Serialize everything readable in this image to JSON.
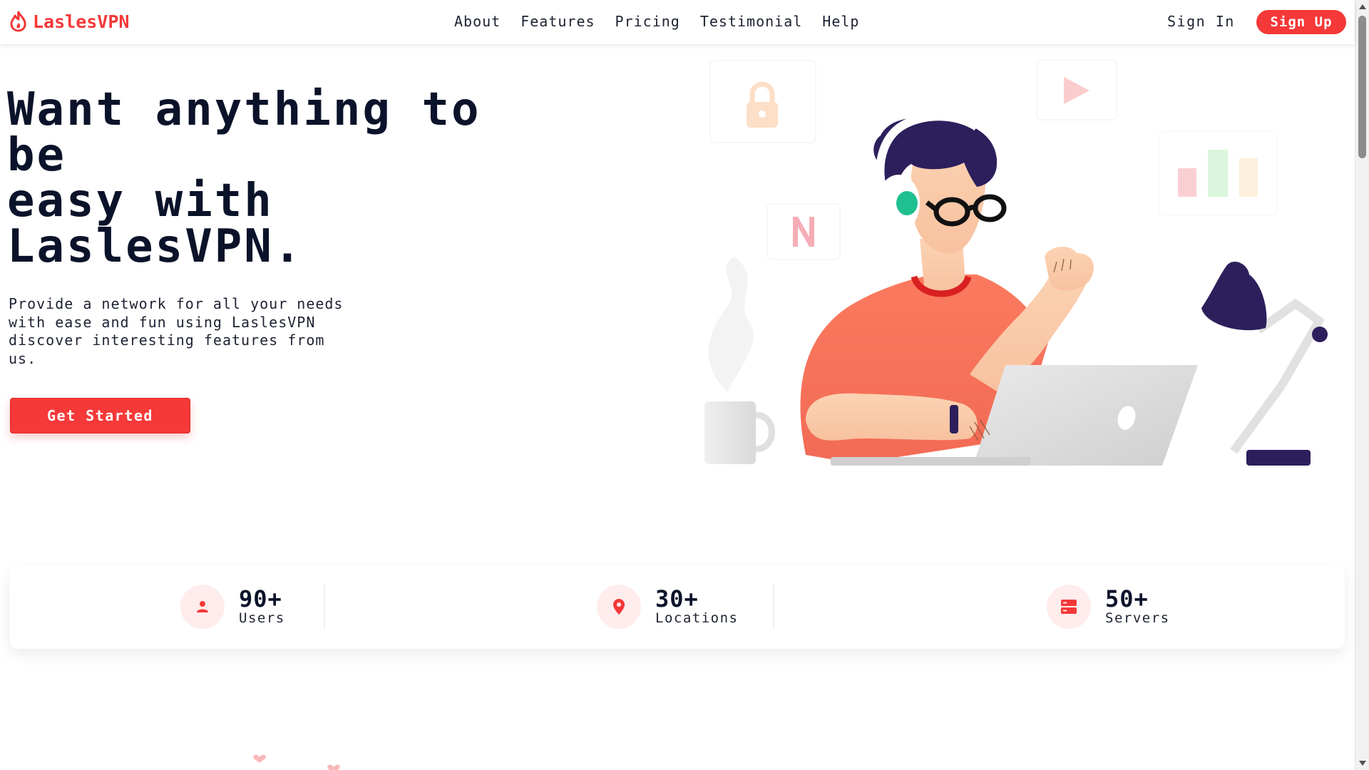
{
  "brand": {
    "name": "LaslesVPN",
    "accent_color": "#f53838",
    "logo_icon": "flame-icon"
  },
  "nav": {
    "links": [
      "About",
      "Features",
      "Pricing",
      "Testimonial",
      "Help"
    ],
    "sign_in": "Sign In",
    "sign_up": "Sign Up"
  },
  "hero": {
    "title_lines": [
      "Want anything to",
      "be",
      "easy with",
      "LaslesVPN."
    ],
    "description": "Provide a network for all your needs with ease and fun using LaslesVPN discover interesting features from us.",
    "cta": "Get Started",
    "illustration": "person-with-headphones-using-laptop"
  },
  "stats": [
    {
      "value": "90+",
      "label": "Users",
      "icon": "user-icon"
    },
    {
      "value": "30+",
      "label": "Locations",
      "icon": "location-pin-icon"
    },
    {
      "value": "50+",
      "label": "Servers",
      "icon": "server-icon"
    }
  ]
}
